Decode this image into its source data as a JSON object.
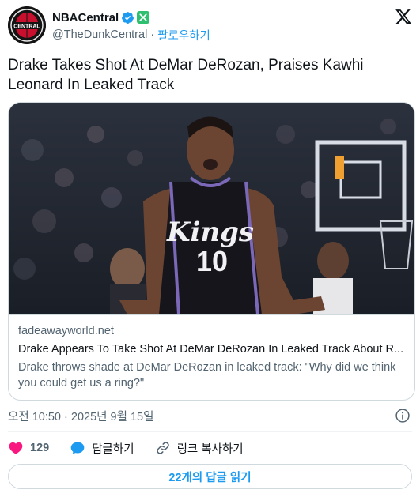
{
  "author": {
    "name": "NBACentral",
    "handle": "@TheDunkCentral",
    "separator": "·",
    "follow_label": "팔로우하기",
    "avatar_text": "CENTRAL"
  },
  "tweet": {
    "text": "Drake Takes Shot At DeMar DeRozan, Praises Kawhi Leonard In Leaked Track"
  },
  "card": {
    "jersey_brand": "Kings",
    "jersey_number": "10",
    "domain": "fadeawayworld.net",
    "title": "Drake Appears To Take Shot At DeMar DeRozan In Leaked Track About R...",
    "description": "Drake throws shade at DeMar DeRozan in leaked track: \"Why did we think you could get us a ring?\""
  },
  "meta": {
    "timestamp": "오전 10:50 · 2025년 9월 15일"
  },
  "actions": {
    "like_count": "129",
    "reply_label": "답글하기",
    "copy_link_label": "링크 복사하기"
  },
  "replies_button": {
    "label": "22개의 답글 읽기"
  },
  "colors": {
    "accent": "#1d9bf0",
    "like": "#f91880",
    "verified": "#1d9bf0",
    "affiliate": "#2fbf71"
  },
  "icons": [
    "x-logo-icon",
    "verified-badge-icon",
    "affiliate-badge-icon",
    "info-icon",
    "heart-icon",
    "reply-bubble-icon",
    "link-icon"
  ]
}
